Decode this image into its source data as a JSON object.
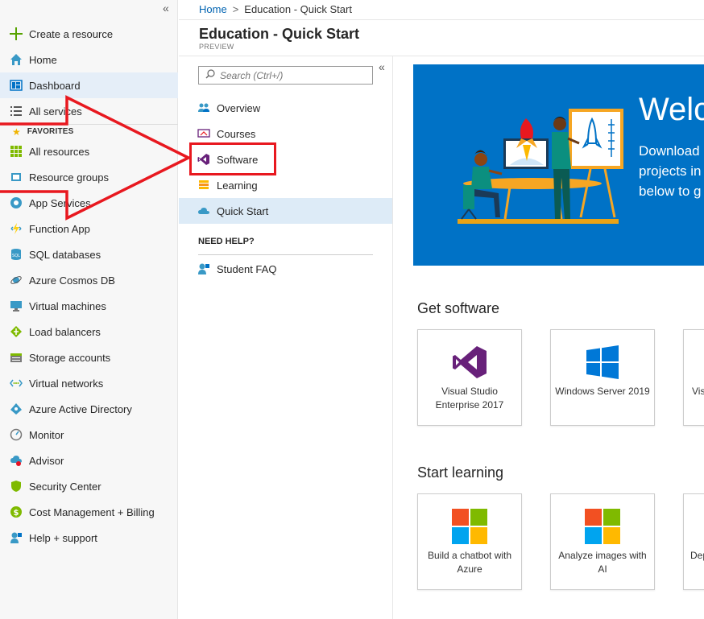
{
  "leftnav": {
    "collapse": "«",
    "items": [
      {
        "label": "Create a resource",
        "icon": "plus-icon"
      },
      {
        "label": "Home",
        "icon": "home-icon"
      },
      {
        "label": "Dashboard",
        "icon": "dashboard-icon"
      },
      {
        "label": "All services",
        "icon": "list-icon"
      }
    ],
    "favorites_label": "FAVORITES",
    "favorites": [
      {
        "label": "All resources",
        "icon": "grid-icon"
      },
      {
        "label": "Resource groups",
        "icon": "resource-groups-icon"
      },
      {
        "label": "App Services",
        "icon": "app-services-icon"
      },
      {
        "label": "Function App",
        "icon": "function-app-icon"
      },
      {
        "label": "SQL databases",
        "icon": "sql-icon"
      },
      {
        "label": "Azure Cosmos DB",
        "icon": "cosmos-icon"
      },
      {
        "label": "Virtual machines",
        "icon": "vm-icon"
      },
      {
        "label": "Load balancers",
        "icon": "load-balancer-icon"
      },
      {
        "label": "Storage accounts",
        "icon": "storage-icon"
      },
      {
        "label": "Virtual networks",
        "icon": "vnet-icon"
      },
      {
        "label": "Azure Active Directory",
        "icon": "aad-icon"
      },
      {
        "label": "Monitor",
        "icon": "monitor-icon"
      },
      {
        "label": "Advisor",
        "icon": "advisor-icon"
      },
      {
        "label": "Security Center",
        "icon": "shield-icon"
      },
      {
        "label": "Cost Management + Billing",
        "icon": "billing-icon"
      },
      {
        "label": "Help + support",
        "icon": "help-icon"
      }
    ]
  },
  "header": {
    "breadcrumb_home": "Home",
    "breadcrumb_sep": ">",
    "breadcrumb_current": "Education - Quick Start",
    "title": "Education - Quick Start",
    "subtitle": "PREVIEW"
  },
  "midmenu": {
    "collapse": "«",
    "search_placeholder": "Search (Ctrl+/)",
    "items": [
      {
        "label": "Overview",
        "icon": "overview-icon"
      },
      {
        "label": "Courses",
        "icon": "courses-icon"
      },
      {
        "label": "Software",
        "icon": "visual-studio-icon"
      },
      {
        "label": "Learning",
        "icon": "learning-icon"
      },
      {
        "label": "Quick Start",
        "icon": "cloud-icon"
      }
    ],
    "need_help": "NEED HELP?",
    "faq": "Student FAQ"
  },
  "hero": {
    "title": "Welc",
    "lines": [
      "Download",
      "projects in",
      "below to g"
    ]
  },
  "get_software": {
    "title": "Get software",
    "tiles": [
      {
        "label": "Visual Studio Enterprise 2017",
        "icon": "visual-studio-icon"
      },
      {
        "label": "Windows Server 2019",
        "icon": "windows-icon"
      },
      {
        "label": "Vis",
        "icon": "none"
      }
    ]
  },
  "start_learning": {
    "title": "Start learning",
    "tiles": [
      {
        "label": "Build a chatbot with Azure",
        "icon": "microsoft-logo-icon"
      },
      {
        "label": "Analyze images with AI",
        "icon": "microsoft-logo-icon"
      },
      {
        "label": "Dep",
        "icon": "none"
      }
    ]
  },
  "colors": {
    "accent": "#0072c6",
    "annotation": "#e8181f",
    "vs_purple": "#68217a"
  }
}
